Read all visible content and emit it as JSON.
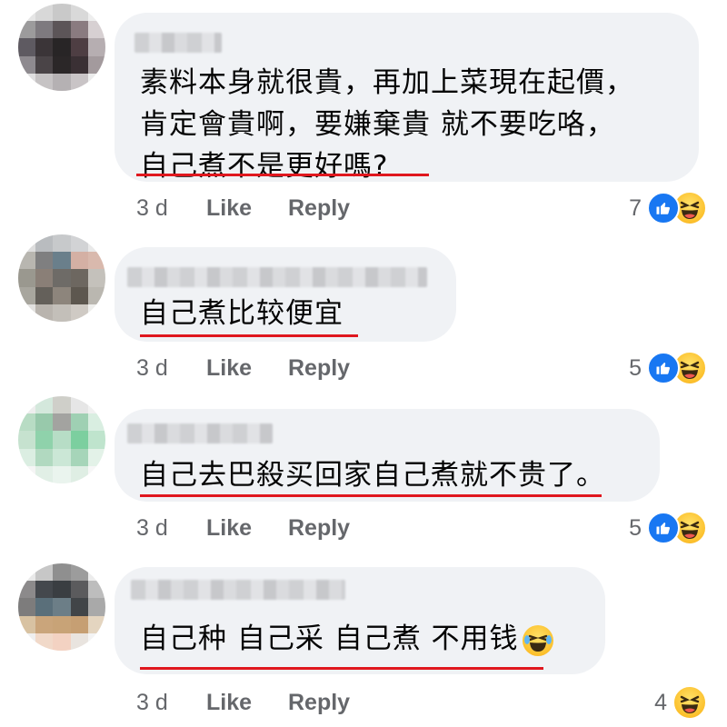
{
  "comments": [
    {
      "text": "素料本身就很貴，再加上菜現在起價，\n肯定會貴啊，要嫌棄貴 就不要吃咯，\n自己煮不是更好嗎?",
      "time": "3 d",
      "like_label": "Like",
      "reply_label": "Reply",
      "reaction_count": "7",
      "reactions": [
        "like-icon",
        "haha-icon"
      ],
      "avatar_colors": [
        "#e6e6e6",
        "#d8d8d8",
        "#c9c9c9",
        "#d9d9d9",
        "#eeeeee",
        "#9c9b9c",
        "#7e7a7f",
        "#5c5558",
        "#8a7b80",
        "#d7d0d2",
        "#5e5a61",
        "#3b3538",
        "#282526",
        "#4e3e43",
        "#b6aeb1",
        "#8e8a8f",
        "#4a4447",
        "#2b2728",
        "#3a3034",
        "#a39a9d",
        "#e0dfe0",
        "#c6c3c4",
        "#b5b1b3",
        "#c9c4c6",
        "#ececec"
      ]
    },
    {
      "text": "自己煮比较便宜",
      "time": "3 d",
      "like_label": "Like",
      "reply_label": "Reply",
      "reaction_count": "5",
      "reactions": [
        "like-icon",
        "haha-icon"
      ],
      "avatar_colors": [
        "#dedede",
        "#b9bcbf",
        "#c7c9cb",
        "#d2d3d5",
        "#e9e9e9",
        "#b8b6b0",
        "#7f7f80",
        "#6a7f8b",
        "#d4b0a4",
        "#d9b9ad",
        "#9a988f",
        "#8a7f77",
        "#6e6b67",
        "#6d6760",
        "#c4c1bb",
        "#a8a69e",
        "#64605a",
        "#8d857c",
        "#5d574f",
        "#bab7b0",
        "#e2e1df",
        "#b9b4ae",
        "#c3bfb9",
        "#cfcac4",
        "#eeeeec"
      ]
    },
    {
      "text": "自己去巴殺买回家自己煮就不贵了。",
      "time": "3 d",
      "like_label": "Like",
      "reply_label": "Reply",
      "reaction_count": "5",
      "reactions": [
        "like-icon",
        "haha-icon"
      ],
      "avatar_colors": [
        "#eeeeee",
        "#d4e8dc",
        "#cfcfc9",
        "#e6e6e6",
        "#f1f1f1",
        "#b8dcc4",
        "#98c9ab",
        "#a3a3a0",
        "#9fd0b3",
        "#d9eee1",
        "#c6e2cf",
        "#8fd2ab",
        "#b7ddc6",
        "#7ccf9f",
        "#bfe4cd",
        "#dbeee2",
        "#b1d9c0",
        "#cbe7d6",
        "#a6d5b9",
        "#e3f2e8",
        "#f5f5f5",
        "#e1efe6",
        "#eaf4ee",
        "#dfeee4",
        "#f7f7f7"
      ]
    },
    {
      "text": "自己种 自己采 自己煮 不用钱",
      "time": "3 d",
      "like_label": "Like",
      "reply_label": "Reply",
      "reaction_count": "4",
      "reactions": [
        "haha-icon"
      ],
      "avatar_colors": [
        "#e9e9e9",
        "#c7c7c7",
        "#8f8f8f",
        "#9c9c9c",
        "#ececec",
        "#8c8a8b",
        "#44484d",
        "#3a3e42",
        "#5b5b5d",
        "#bdbdbd",
        "#7d7c7c",
        "#5a6f7a",
        "#6c7e87",
        "#414548",
        "#a9a9a9",
        "#d8c2a2",
        "#caa57b",
        "#c8a377",
        "#c69f73",
        "#e4d5c0",
        "#efefef",
        "#f1d9c9",
        "#f3d2c2",
        "#e9e4df",
        "#f4f4f4"
      ]
    }
  ]
}
